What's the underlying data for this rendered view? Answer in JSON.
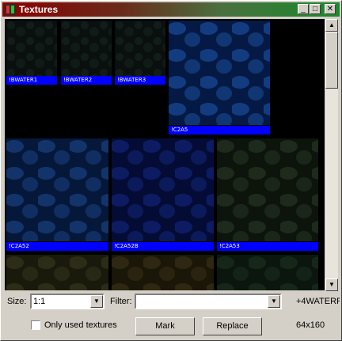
{
  "window": {
    "title": "Textures"
  },
  "titlebar_buttons": {
    "minimize": "_",
    "maximize": "□",
    "close": "✕"
  },
  "textures": [
    {
      "name": "!BWATER1",
      "colors": [
        "#0a100e",
        "#1a2a26"
      ]
    },
    {
      "name": "!BWATER2",
      "colors": [
        "#0a100e",
        "#1a2a26"
      ]
    },
    {
      "name": "!BWATER3",
      "colors": [
        "#0a100e",
        "#1a2a26"
      ]
    },
    {
      "name": "!C2A5",
      "colors": [
        "#041a44",
        "#1e58b0"
      ]
    },
    {
      "name": "!C2A52",
      "colors": [
        "#06183a",
        "#1d4a92"
      ]
    },
    {
      "name": "!C2A52B",
      "colors": [
        "#040c36",
        "#142a86"
      ]
    },
    {
      "name": "!C2A53",
      "colors": [
        "#0c140c",
        "#2c3c2a"
      ]
    },
    {
      "name": "",
      "colors": [
        "#1a1a0c",
        "#3c3a22"
      ]
    },
    {
      "name": "",
      "colors": [
        "#1a1608",
        "#3e3418"
      ]
    },
    {
      "name": "",
      "colors": [
        "#0a160e",
        "#1e3424"
      ]
    }
  ],
  "controls": {
    "size_label": "Size:",
    "size_value": "1:1",
    "filter_label": "Filter:",
    "filter_value": "",
    "current_texture": "+4WATERF",
    "only_used_label": "Only used textures",
    "mark_label": "Mark",
    "replace_label": "Replace",
    "dimensions": "64x160"
  },
  "scroll_arrows": {
    "up": "▲",
    "down": "▼",
    "combo": "▼"
  },
  "colors": {
    "label_bg": "#0000ff",
    "viewport_bg": "#000000",
    "face": "#d4d0c8"
  }
}
